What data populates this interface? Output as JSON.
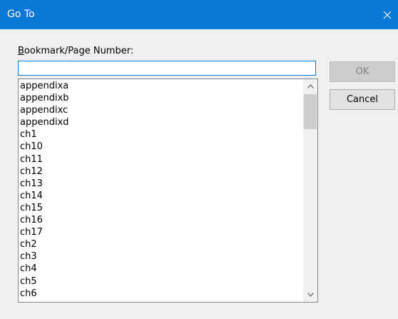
{
  "window": {
    "title": "Go To"
  },
  "field": {
    "label_accel": "B",
    "label_rest": "ookmark/Page Number:",
    "value": ""
  },
  "list": {
    "items": [
      "appendixa",
      "appendixb",
      "appendixc",
      "appendixd",
      "ch1",
      "ch10",
      "ch11",
      "ch12",
      "ch13",
      "ch14",
      "ch15",
      "ch16",
      "ch17",
      "ch2",
      "ch3",
      "ch4",
      "ch5",
      "ch6"
    ]
  },
  "buttons": {
    "ok_label": "OK",
    "cancel_label": "Cancel"
  },
  "icons": {
    "close": "close-icon",
    "scroll_up": "chevron-up-icon",
    "scroll_down": "chevron-down-icon"
  },
  "colors": {
    "titlebar": "#0a78d7",
    "input_border": "#0078d7"
  }
}
